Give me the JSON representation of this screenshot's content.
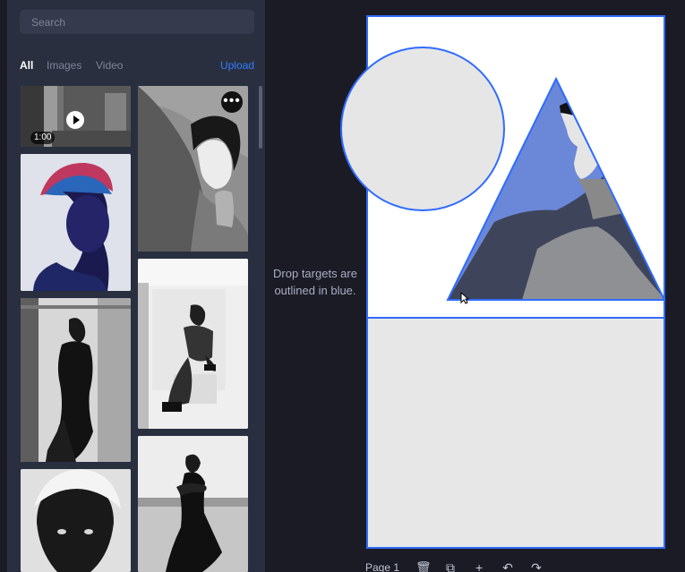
{
  "sidebar": {
    "search_placeholder": "Search",
    "tabs": [
      {
        "label": "All",
        "active": true
      },
      {
        "label": "Images",
        "active": false
      },
      {
        "label": "Video",
        "active": false
      }
    ],
    "upload_label": "Upload",
    "media": [
      {
        "type": "video",
        "duration": "1:00",
        "icon": "play-icon"
      },
      {
        "type": "image",
        "menu": "more-icon"
      },
      {
        "type": "image"
      },
      {
        "type": "image"
      },
      {
        "type": "image"
      },
      {
        "type": "image"
      },
      {
        "type": "image"
      }
    ]
  },
  "canvas": {
    "drop_hint": "Drop targets are outlined in blue.",
    "page_label": "Page 1",
    "accent_color": "#2f6cff"
  }
}
